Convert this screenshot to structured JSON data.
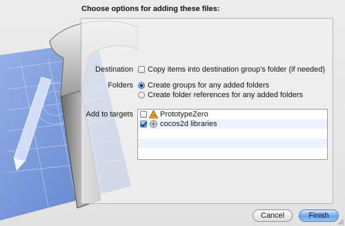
{
  "dialog": {
    "heading": "Choose options for adding these files:",
    "destination": {
      "label": "Destination",
      "checkbox_label": "Copy items into destination group's folder (if needed)",
      "checked": false
    },
    "folders": {
      "label": "Folders",
      "options": [
        {
          "label": "Create groups for any added folders",
          "selected": true
        },
        {
          "label": "Create folder references for any added folders",
          "selected": false
        }
      ]
    },
    "targets": {
      "label": "Add to targets",
      "items": [
        {
          "label": "PrototypeZero",
          "checked": false,
          "icon": "app-target-icon"
        },
        {
          "label": "cocos2d libraries",
          "checked": true,
          "icon": "library-target-icon"
        }
      ]
    },
    "buttons": {
      "cancel": "Cancel",
      "finish": "Finish"
    }
  },
  "colors": {
    "blueprint": "#5f86d4",
    "finish_button": "#6aa4ea",
    "selection": "#153e7e"
  }
}
